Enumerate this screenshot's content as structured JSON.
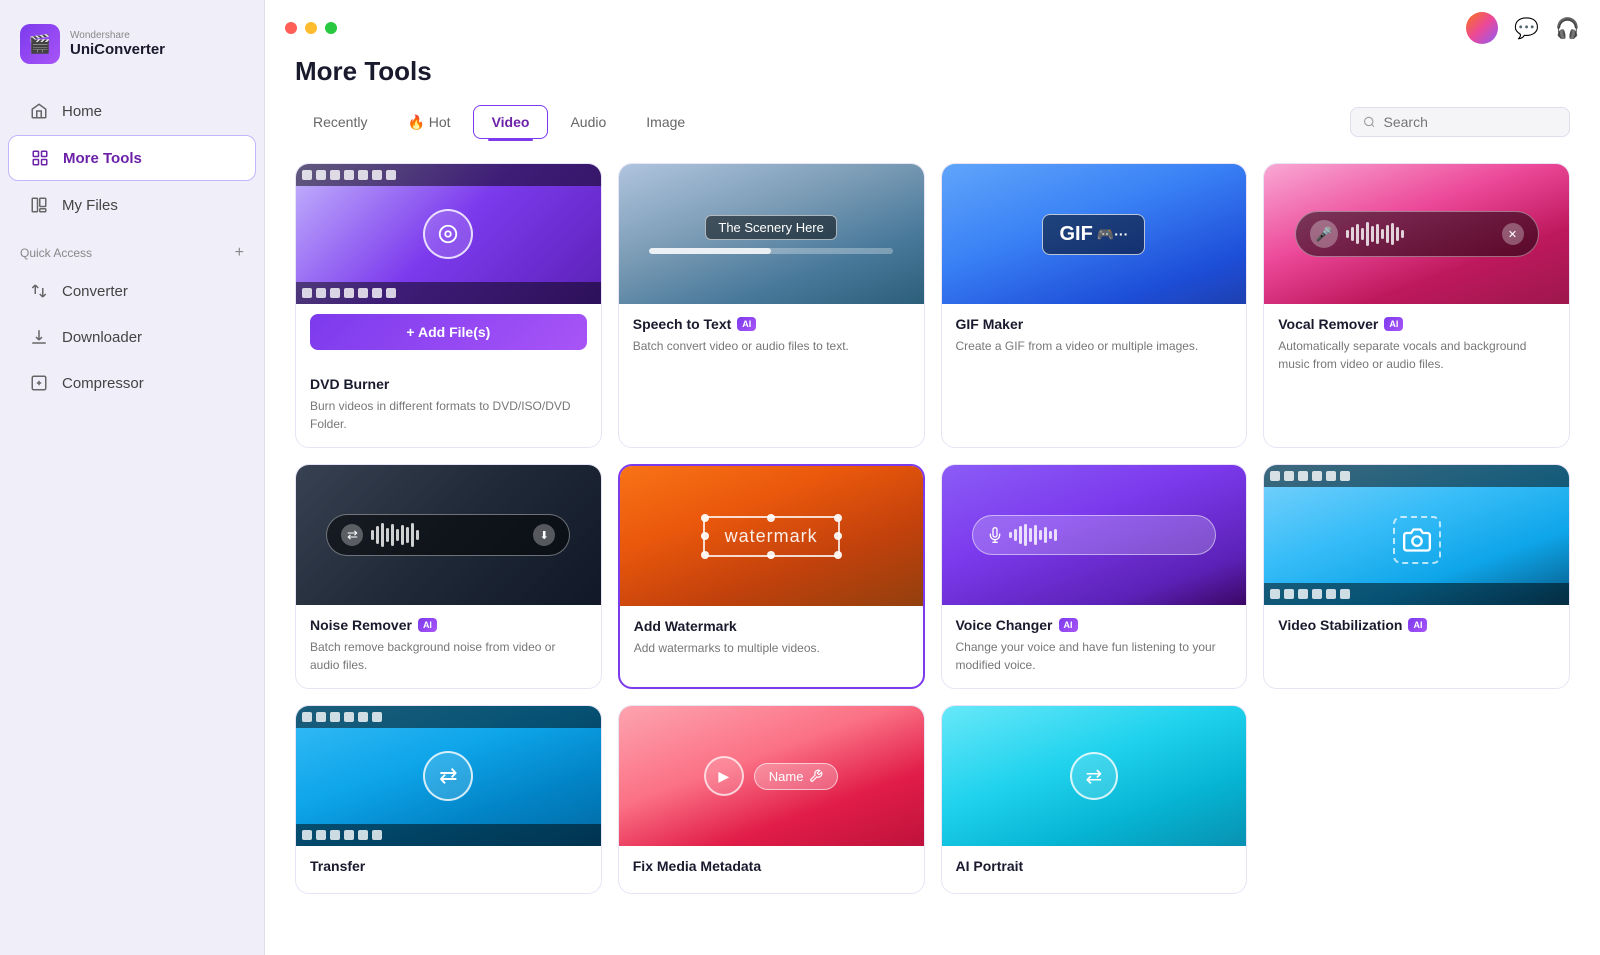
{
  "sidebar": {
    "logo": {
      "brand": "Wondershare",
      "name": "UniConverter",
      "icon": "🎬"
    },
    "nav": [
      {
        "id": "home",
        "label": "Home",
        "icon": "⌂",
        "active": false
      },
      {
        "id": "more-tools",
        "label": "More Tools",
        "icon": "⊞",
        "active": true
      },
      {
        "id": "my-files",
        "label": "My Files",
        "icon": "📁",
        "active": false
      }
    ],
    "quick_access_label": "Quick Access",
    "quick_access_add": "+",
    "quick_access_items": [
      {
        "id": "converter",
        "label": "Converter",
        "icon": "↔"
      },
      {
        "id": "downloader",
        "label": "Downloader",
        "icon": "⬇"
      },
      {
        "id": "compressor",
        "label": "Compressor",
        "icon": "⊡"
      }
    ]
  },
  "titlebar": {
    "icons": [
      "💬",
      "🎧"
    ]
  },
  "main": {
    "title": "More Tools",
    "tabs": [
      {
        "id": "recently",
        "label": "Recently",
        "active": false
      },
      {
        "id": "hot",
        "label": "🔥 Hot",
        "active": false
      },
      {
        "id": "video",
        "label": "Video",
        "active": true
      },
      {
        "id": "audio",
        "label": "Audio",
        "active": false
      },
      {
        "id": "image",
        "label": "Image",
        "active": false
      }
    ],
    "search_placeholder": "Search",
    "tools": [
      {
        "id": "dvd-burner",
        "title": "DVD Burner",
        "desc": "Burn videos in different formats to DVD/ISO/DVD Folder.",
        "ai": false,
        "add_files": true,
        "add_files_label": "+ Add File(s)",
        "bg": "dvd"
      },
      {
        "id": "speech-to-text",
        "title": "Speech to Text",
        "desc": "Batch convert video or audio files to text.",
        "ai": true,
        "bg": "speech"
      },
      {
        "id": "gif-maker",
        "title": "GIF Maker",
        "desc": "Create a GIF from a video or multiple images.",
        "ai": false,
        "bg": "gif"
      },
      {
        "id": "vocal-remover",
        "title": "Vocal Remover",
        "desc": "Automatically separate vocals and background music from video or audio files.",
        "ai": true,
        "bg": "vocal"
      },
      {
        "id": "noise-remover",
        "title": "Noise Remover",
        "desc": "Batch remove background noise from video or audio files.",
        "ai": true,
        "bg": "noise"
      },
      {
        "id": "add-watermark",
        "title": "Add Watermark",
        "desc": "Add watermarks to multiple videos.",
        "ai": false,
        "bg": "watermark",
        "selected": true
      },
      {
        "id": "voice-changer",
        "title": "Voice Changer",
        "desc": "Change your voice and have fun listening to your modified voice.",
        "ai": true,
        "bg": "voice"
      },
      {
        "id": "video-stabilization",
        "title": "Video Stabilization",
        "desc": "",
        "ai": true,
        "bg": "stabilize"
      },
      {
        "id": "transfer",
        "title": "Transfer",
        "desc": "",
        "ai": false,
        "bg": "transfer"
      },
      {
        "id": "fix-media-metadata",
        "title": "Fix Media Metadata",
        "desc": "",
        "ai": false,
        "bg": "metadata"
      },
      {
        "id": "ai-portrait",
        "title": "AI Portrait",
        "desc": "",
        "ai": false,
        "bg": "portrait"
      }
    ]
  }
}
